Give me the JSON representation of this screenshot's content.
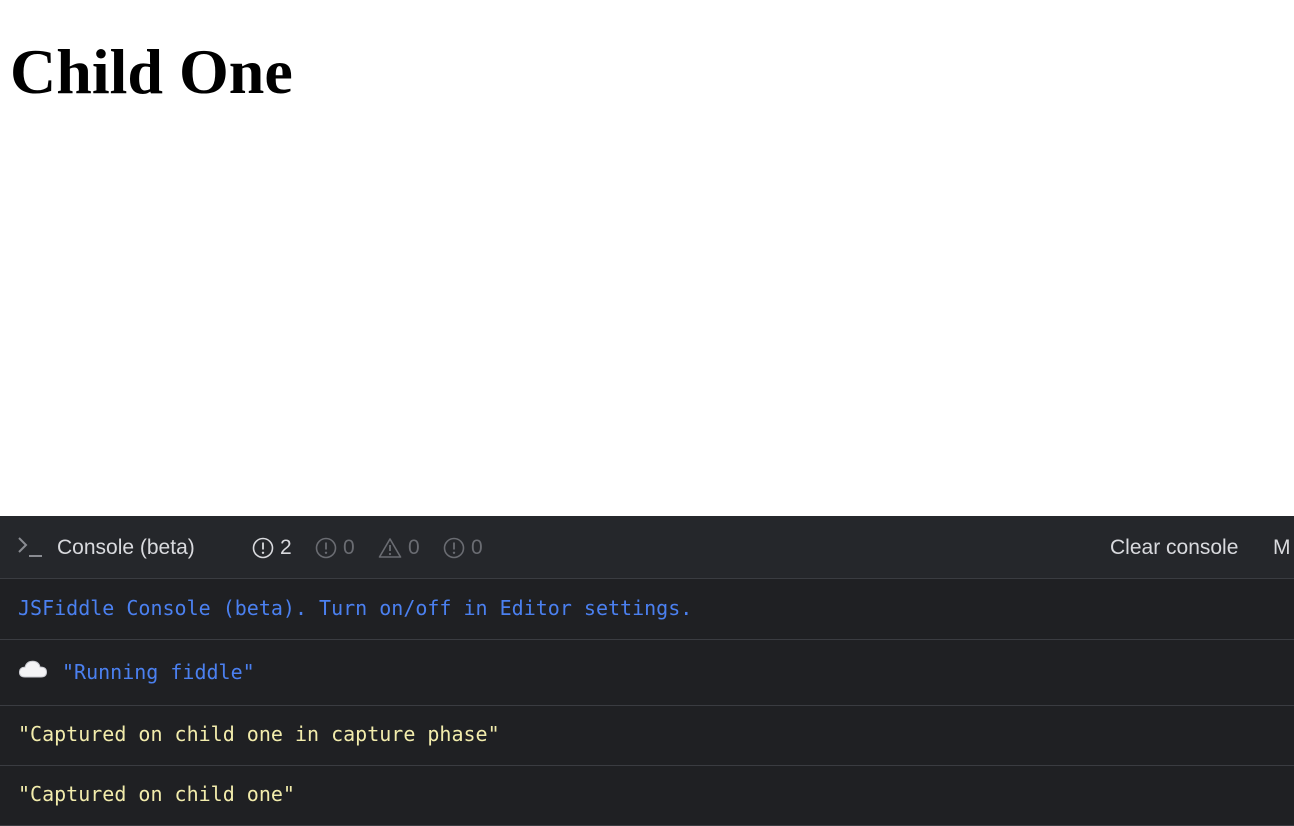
{
  "preview": {
    "heading": "Child One"
  },
  "console": {
    "title": "Console (beta)",
    "counters": [
      {
        "icon": "info-circle-icon",
        "count": "2"
      },
      {
        "icon": "error-circle-icon",
        "count": "0"
      },
      {
        "icon": "warning-triangle-icon",
        "count": "0"
      },
      {
        "icon": "info-circle-icon",
        "count": "0"
      }
    ],
    "clear_label": "Clear console",
    "more_label": "M",
    "logs": [
      {
        "text": "JSFiddle Console (beta). Turn on/off in Editor settings.",
        "color": "#4b80f0"
      },
      {
        "text": "\"Running fiddle\"",
        "color": "#4b80f0",
        "icon": "cloud-icon"
      },
      {
        "text": "\"Captured on child one in capture phase\"",
        "color": "#f2ecac"
      },
      {
        "text": "\"Captured on child one\"",
        "color": "#f2ecac"
      }
    ]
  },
  "colors": {
    "console_bg": "#1f2023",
    "toolbar_bg": "#25272b",
    "divider": "#3a3c41",
    "log_blue": "#4b80f0",
    "log_yellow": "#f2ecac"
  }
}
